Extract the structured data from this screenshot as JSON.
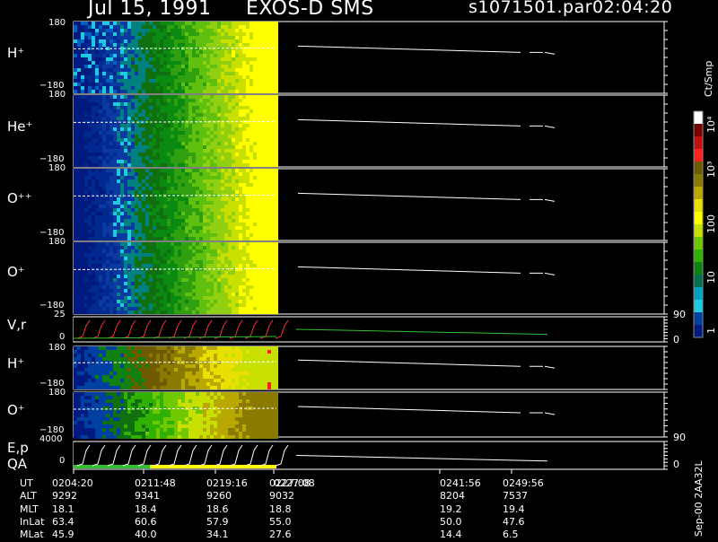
{
  "header": {
    "date": "Jul 15, 1991",
    "title": "EXOS-D SMS",
    "file": "s1071501.par",
    "time": "02:04:20"
  },
  "colorbar": {
    "unit": "Ct/Smp",
    "ticks": [
      "10⁴",
      "10³",
      "100",
      "10",
      "1"
    ],
    "stops": [
      "#ffffff",
      "#7a0000",
      "#c01010",
      "#ff2020",
      "#6e5a00",
      "#8a7a00",
      "#b8a800",
      "#e8e000",
      "#ffff00",
      "#c8e000",
      "#70c800",
      "#30b000",
      "#108010",
      "#007050",
      "#00a0c0",
      "#20c8e0",
      "#0040a0",
      "#001a80"
    ]
  },
  "panels": [
    {
      "id": "h-plus-1",
      "label": "H⁺",
      "ymax": "180",
      "ymin": "−180"
    },
    {
      "id": "he-plus",
      "label": "He⁺",
      "ymax": "180",
      "ymin": "−180"
    },
    {
      "id": "o-plus-plus",
      "label": "O⁺⁺",
      "ymax": "180",
      "ymin": "−180"
    },
    {
      "id": "o-plus-1",
      "label": "O⁺",
      "ymax": "180",
      "ymin": "−180"
    },
    {
      "id": "vr",
      "label": "V,r",
      "ymax": "25",
      "ymin": "0",
      "rmax": "90",
      "rmin": "0"
    },
    {
      "id": "h-plus-2",
      "label": "H⁺",
      "ymax": "180",
      "ymin": "−180"
    },
    {
      "id": "o-plus-2",
      "label": "O⁺",
      "ymax": "180",
      "ymin": "−180"
    },
    {
      "id": "ep",
      "label": "E,p",
      "label2": "QA",
      "ymax": "4000",
      "ymin": "0",
      "rmax": "90",
      "rmin": "0"
    }
  ],
  "time_axis": {
    "ticks": [
      "0204:20",
      "0211:48",
      "0219:16",
      "0227:08",
      "0241:56",
      "0249:56"
    ]
  },
  "table": {
    "rows": [
      {
        "label": "UT",
        "values": [
          "0204:20",
          "0211:48",
          "0219:16",
          "0227:08",
          "0241:56",
          "0249:56"
        ]
      },
      {
        "label": "ALT",
        "values": [
          "9292",
          "9341",
          "9260",
          "9032",
          "8204",
          "7537"
        ]
      },
      {
        "label": "MLT",
        "values": [
          "18.1",
          "18.4",
          "18.6",
          "18.8",
          "19.2",
          "19.4"
        ]
      },
      {
        "label": "InLat",
        "values": [
          "63.4",
          "60.6",
          "57.9",
          "55.0",
          "50.0",
          "47.6"
        ]
      },
      {
        "label": "MLat",
        "values": [
          "45.9",
          "40.0",
          "34.1",
          "27.6",
          "14.4",
          "6.5"
        ]
      }
    ]
  },
  "footer_tag": "Sep-00  2AA32L",
  "chart_data": {
    "type": "heatmap",
    "title": "EXOS-D SMS",
    "x_ticks": [
      "0204:20",
      "0211:48",
      "0219:16",
      "0227:08",
      "0241:56",
      "0249:56"
    ],
    "series": [
      {
        "name": "H⁺",
        "ylim": [
          -180,
          180
        ]
      },
      {
        "name": "He⁺",
        "ylim": [
          -180,
          180
        ]
      },
      {
        "name": "O⁺⁺",
        "ylim": [
          -180,
          180
        ]
      },
      {
        "name": "O⁺",
        "ylim": [
          -180,
          180
        ]
      },
      {
        "name": "V,r",
        "ylim": [
          0,
          25
        ]
      },
      {
        "name": "H⁺",
        "ylim": [
          -180,
          180
        ]
      },
      {
        "name": "O⁺",
        "ylim": [
          -180,
          180
        ]
      },
      {
        "name": "E,p",
        "ylim": [
          0,
          4000
        ]
      }
    ],
    "colorbar_unit": "Ct/Smp"
  }
}
